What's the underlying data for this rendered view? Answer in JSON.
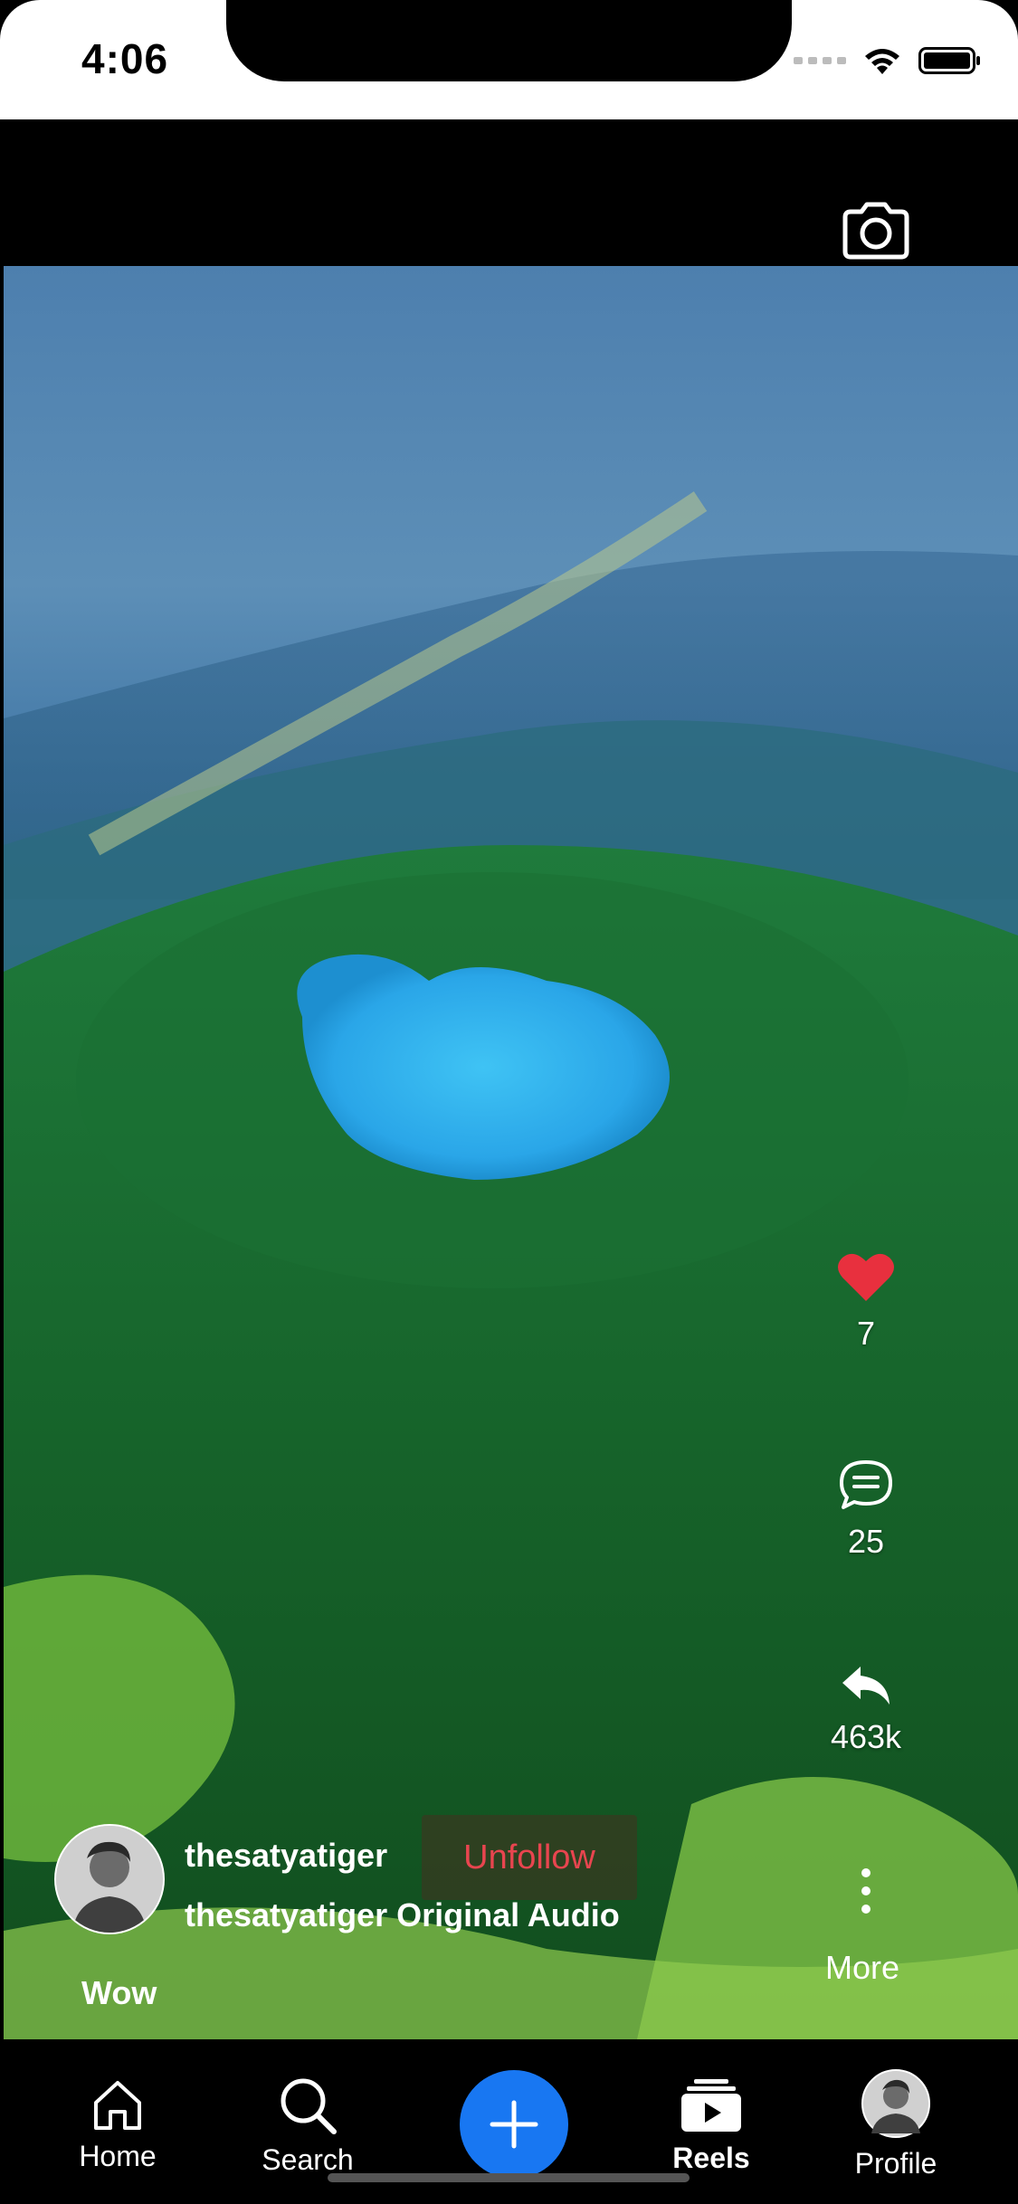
{
  "status_bar": {
    "time": "4:06"
  },
  "reel": {
    "likes": "7",
    "comments": "25",
    "shares": "463k",
    "more_label": "More",
    "username": "thesatyatiger",
    "follow_button": "Unfollow",
    "audio": "thesatyatiger Original Audio",
    "caption": "Wow"
  },
  "nav": {
    "home": "Home",
    "search": "Search",
    "reels": "Reels",
    "profile": "Profile"
  },
  "colors": {
    "like": "#e8303e",
    "follow_text": "#e8454f",
    "add_button": "#1877f2"
  },
  "icons": [
    "camera-icon",
    "heart-icon",
    "comment-icon",
    "share-icon",
    "more-dots-icon",
    "home-icon",
    "search-icon",
    "plus-icon",
    "reels-icon"
  ]
}
